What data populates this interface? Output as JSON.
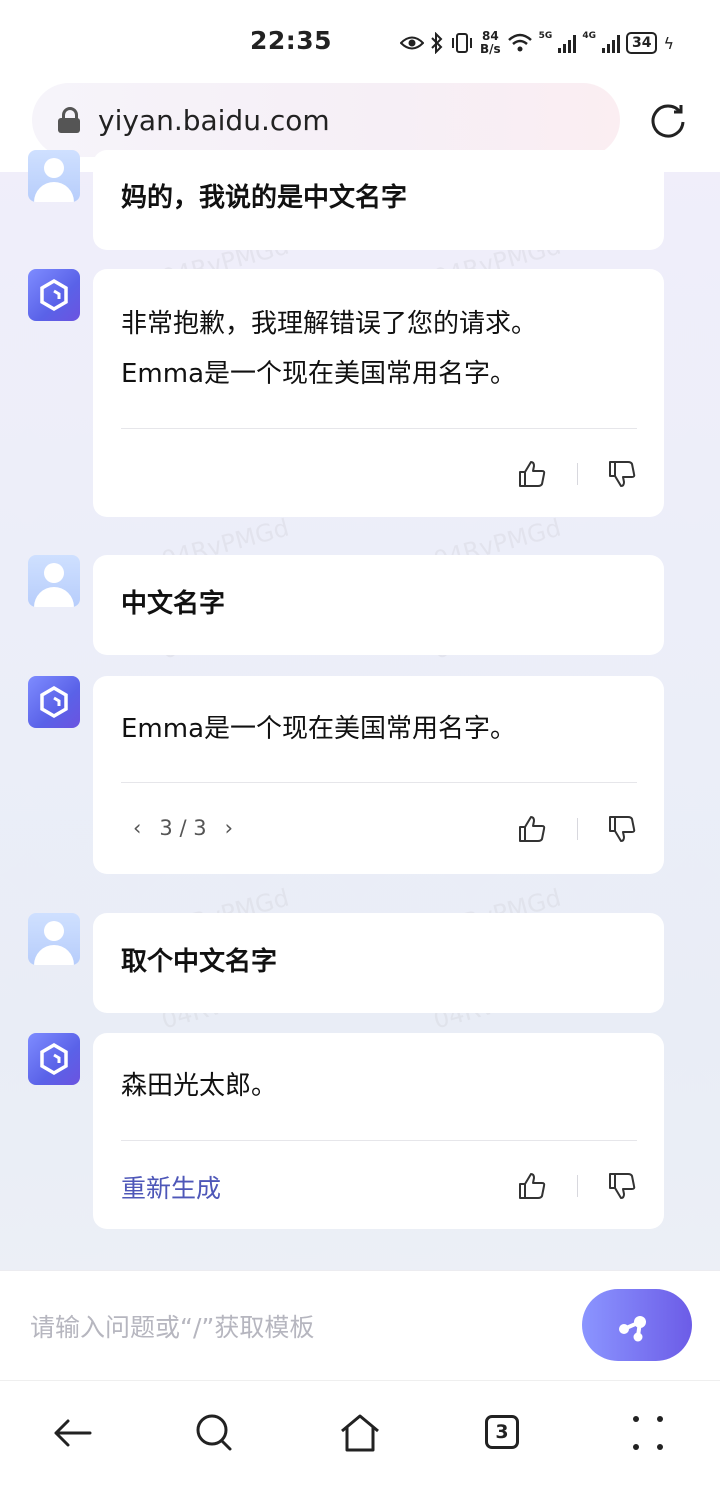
{
  "status_bar": {
    "time": "22:35",
    "net_speed_value": "84",
    "net_speed_unit": "B/s",
    "signal1_label": "5G",
    "signal2_label": "4G",
    "battery": "34"
  },
  "browser": {
    "url": "yiyan.baidu.com",
    "tab_count": "3"
  },
  "watermark": "04RvPMGd",
  "messages": [
    {
      "role": "user",
      "text": "妈的，我说的是中文名字"
    },
    {
      "role": "bot",
      "lines": [
        "非常抱歉，我理解错误了您的请求。",
        "Emma是一个现在美国常用名字。"
      ]
    },
    {
      "role": "user",
      "text": "中文名字"
    },
    {
      "role": "bot",
      "lines": [
        "Emma是一个现在美国常用名字。"
      ],
      "pager": "3 / 3"
    },
    {
      "role": "user",
      "text": "取个中文名字"
    },
    {
      "role": "bot",
      "lines": [
        "森田光太郎。"
      ],
      "regenerate_label": "重新生成"
    }
  ],
  "input": {
    "placeholder": "请输入问题或“/”获取模板"
  },
  "icons": {
    "lock": "lock-icon",
    "reload": "reload-icon",
    "like": "thumbs-up-icon",
    "dislike": "thumbs-down-icon",
    "send": "send-icon",
    "back": "arrow-left-icon",
    "search": "search-icon",
    "home": "home-icon",
    "menu": "more-dots-icon"
  },
  "colors": {
    "accent": "#4e57b8",
    "send_gradient_start": "#8b95ff",
    "send_gradient_end": "#6c5ce7",
    "bot_avatar": "#5a62e8"
  }
}
